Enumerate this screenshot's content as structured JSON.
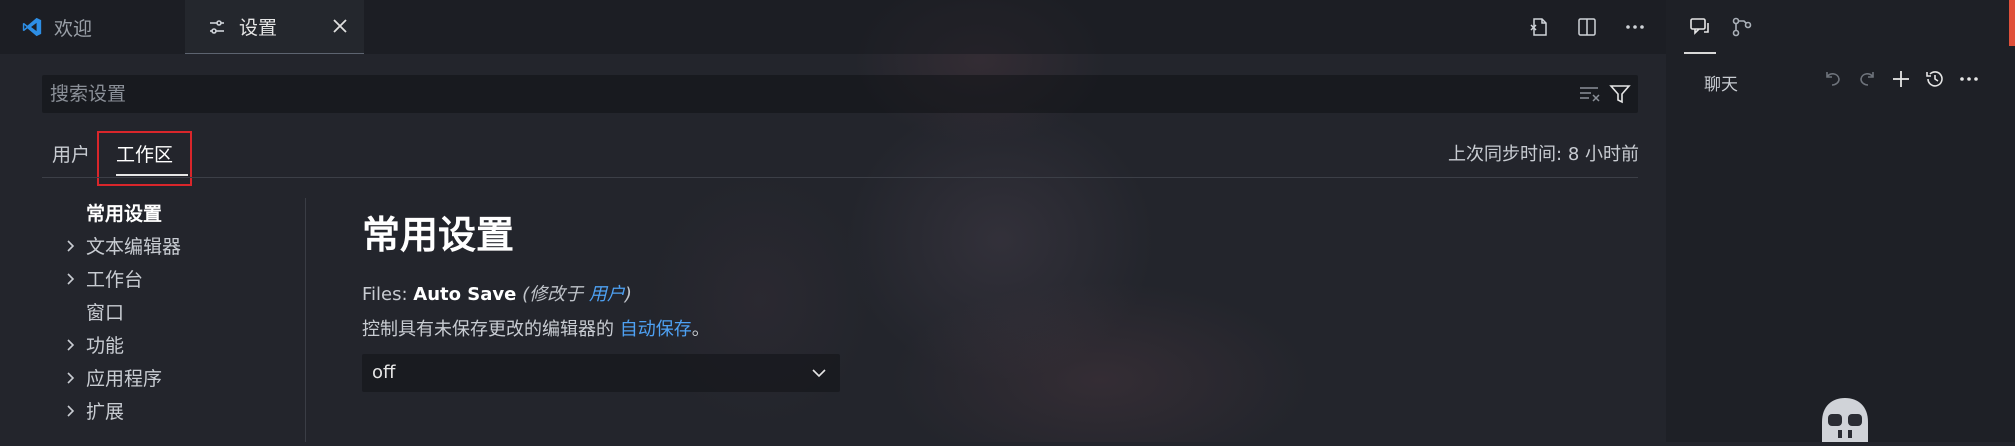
{
  "tabs": [
    {
      "label": "欢迎",
      "icon": "vscode-logo-icon"
    },
    {
      "label": "设置",
      "icon": "settings-sliders-icon",
      "active": true
    }
  ],
  "editor_actions": [
    "open-settings-json-icon",
    "split-editor-icon",
    "more-actions-icon"
  ],
  "search": {
    "placeholder": "搜索设置",
    "value": ""
  },
  "scope": {
    "user_label": "用户",
    "workspace_label": "工作区",
    "selected": "工作区"
  },
  "sync_status": "上次同步时间: 8 小时前",
  "toc": [
    {
      "label": "常用设置",
      "expandable": false,
      "active": true
    },
    {
      "label": "文本编辑器",
      "expandable": true
    },
    {
      "label": "工作台",
      "expandable": true
    },
    {
      "label": "窗口",
      "expandable": false
    },
    {
      "label": "功能",
      "expandable": true
    },
    {
      "label": "应用程序",
      "expandable": true
    },
    {
      "label": "扩展",
      "expandable": true
    }
  ],
  "section": {
    "title": "常用设置"
  },
  "setting": {
    "category": "Files: ",
    "key": "Auto Save",
    "modified_prefix": "(修改于 ",
    "modified_link": "用户",
    "modified_suffix": ")",
    "desc_prefix": "控制具有未保存更改的编辑器的 ",
    "desc_link": "自动保存",
    "desc_suffix": "。",
    "value": "off"
  },
  "panel": {
    "chat_label": "聊天",
    "tab_icons": [
      "chat-icon",
      "source-control-graph-icon"
    ],
    "actions": [
      "undo-icon",
      "redo-icon",
      "add-icon",
      "history-icon",
      "more-actions-icon"
    ]
  },
  "colors": {
    "background": "#23252c",
    "link": "#4ea1f3",
    "highlight_box": "#d9262b",
    "vscode_blue": "#2d8ee5",
    "edge_accent": "#e0503a"
  }
}
